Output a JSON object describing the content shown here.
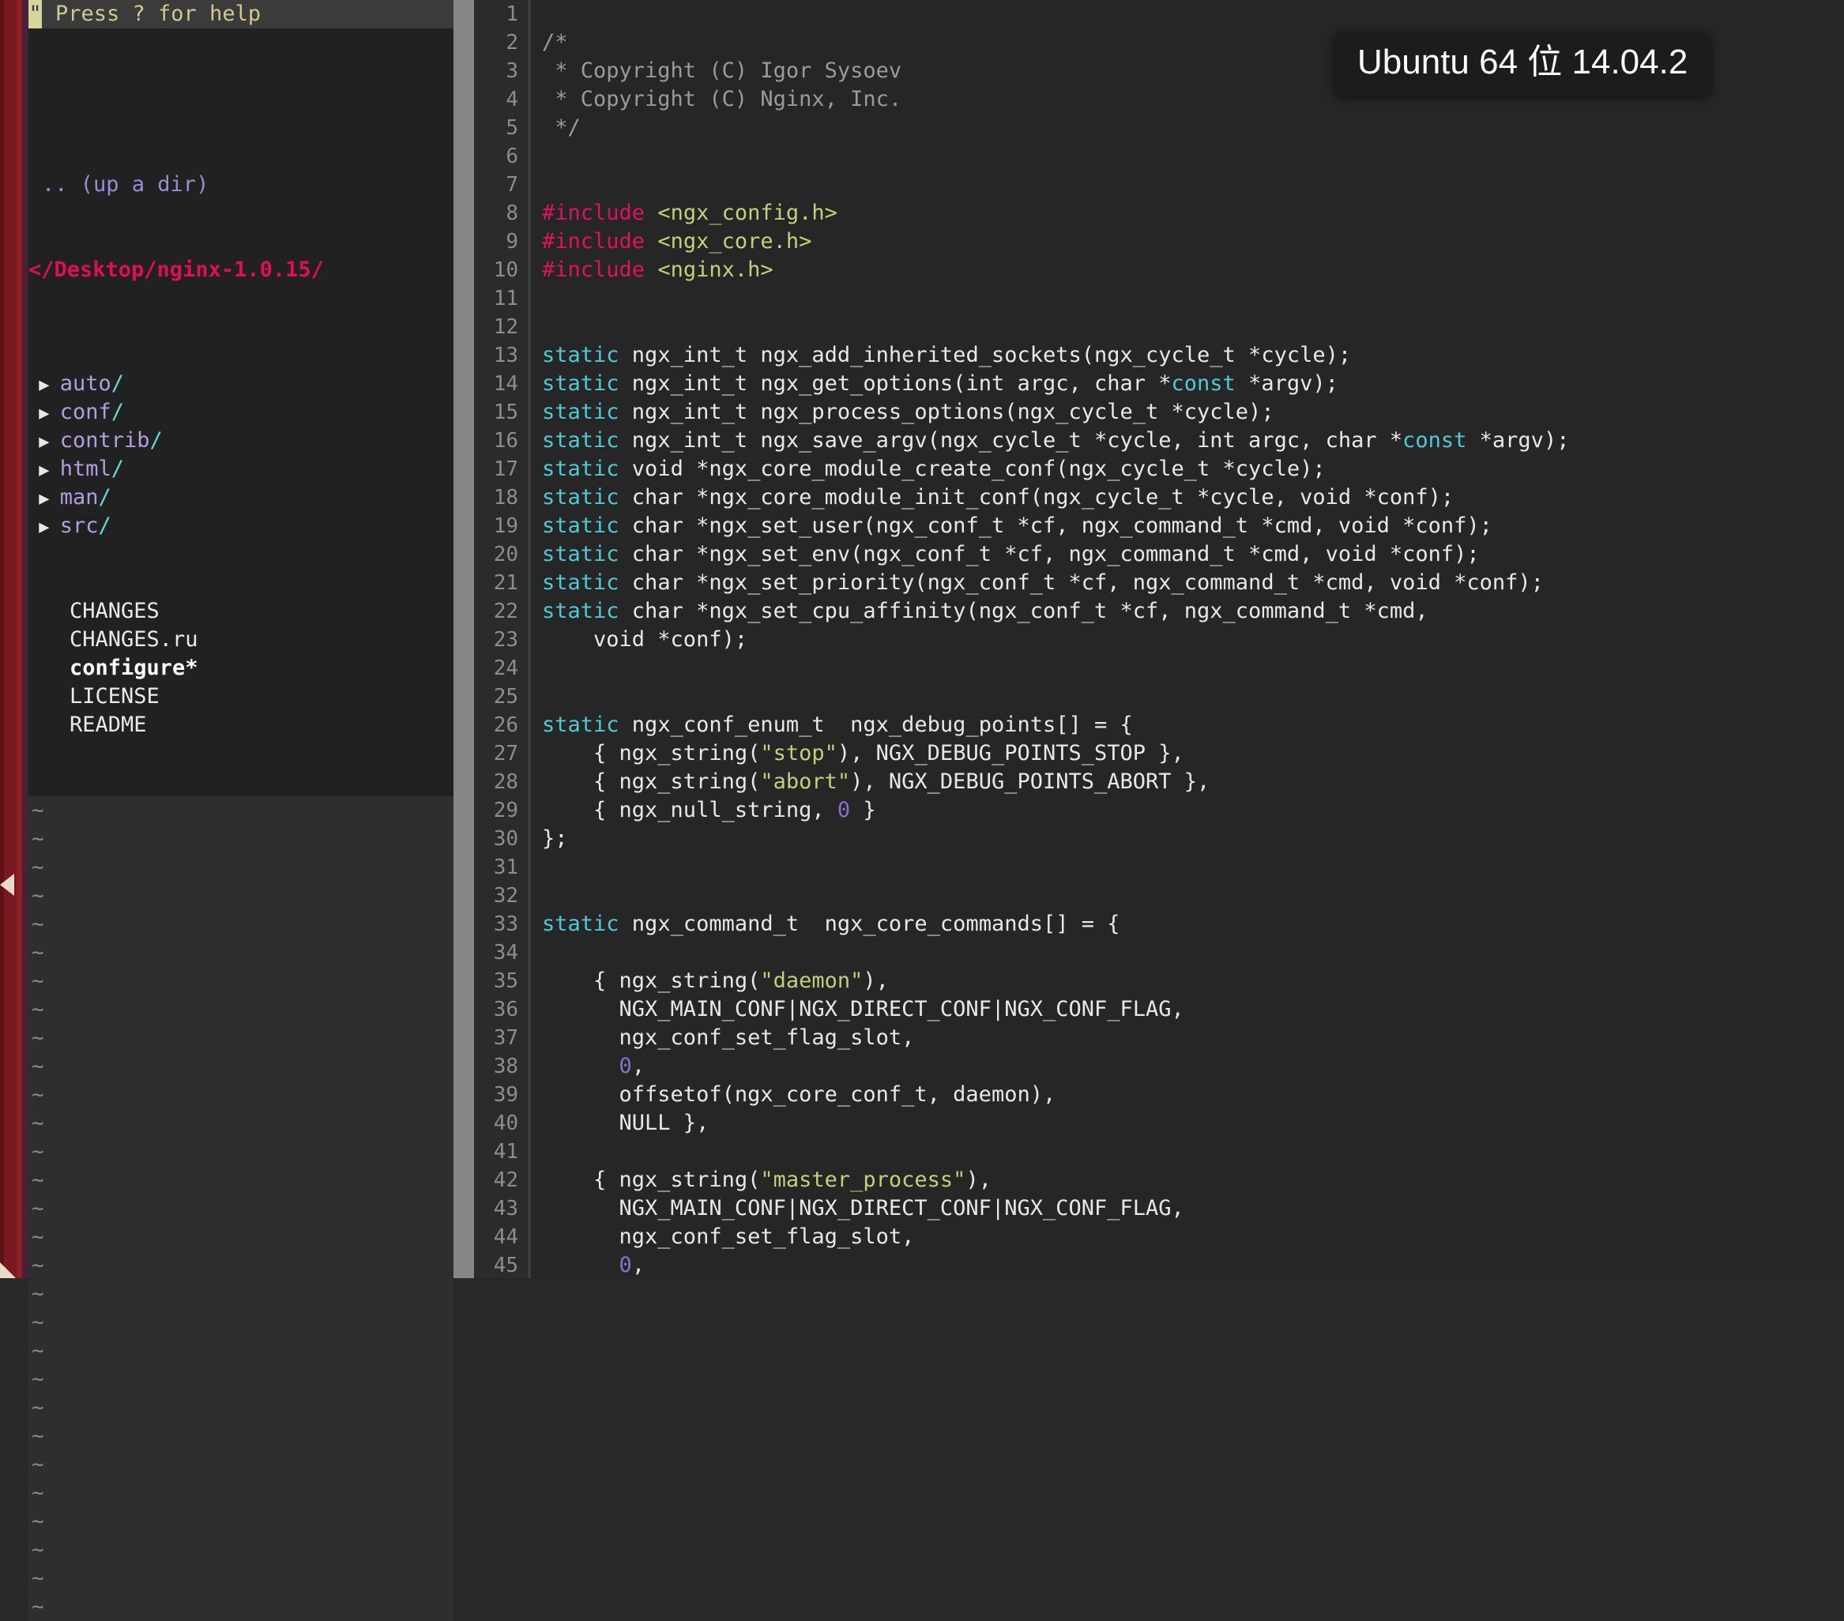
{
  "vm_overlay": {
    "title": "Ubuntu 64 位 14.04.2"
  },
  "nerdtree": {
    "help_hint": "Press ? for help",
    "cursor_char": "\"",
    "up_a_dir": ".. (up a dir)",
    "root_path": "</Desktop/nginx-1.0.15/",
    "arrow_glyph": "▶",
    "directories": [
      {
        "name": "auto",
        "slash": "/"
      },
      {
        "name": "conf",
        "slash": "/"
      },
      {
        "name": "contrib",
        "slash": "/"
      },
      {
        "name": "html",
        "slash": "/"
      },
      {
        "name": "man",
        "slash": "/"
      },
      {
        "name": "src",
        "slash": "/"
      }
    ],
    "files": [
      {
        "name": "CHANGES",
        "executable": false
      },
      {
        "name": "CHANGES.ru",
        "executable": false
      },
      {
        "name": "configure*",
        "executable": true
      },
      {
        "name": "LICENSE",
        "executable": false
      },
      {
        "name": "README",
        "executable": false
      }
    ],
    "empty_marker": "~",
    "empty_marker_count": 29
  },
  "editor": {
    "line_numbers": [
      1,
      2,
      3,
      4,
      5,
      6,
      7,
      8,
      9,
      10,
      11,
      12,
      13,
      14,
      15,
      16,
      17,
      18,
      19,
      20,
      21,
      22,
      23,
      24,
      25,
      26,
      27,
      28,
      29,
      30,
      31,
      32,
      33,
      34,
      35,
      36,
      37,
      38,
      39,
      40,
      41,
      42,
      43,
      44,
      45
    ],
    "lines": [
      {
        "n": 1,
        "tokens": []
      },
      {
        "n": 2,
        "tokens": [
          {
            "t": "/*",
            "c": "k-comment"
          }
        ]
      },
      {
        "n": 3,
        "tokens": [
          {
            "t": " * Copyright (C) Igor Sysoev",
            "c": "k-comment"
          }
        ]
      },
      {
        "n": 4,
        "tokens": [
          {
            "t": " * Copyright (C) Nginx, Inc.",
            "c": "k-comment"
          }
        ]
      },
      {
        "n": 5,
        "tokens": [
          {
            "t": " */",
            "c": "k-comment"
          }
        ]
      },
      {
        "n": 6,
        "tokens": []
      },
      {
        "n": 7,
        "tokens": []
      },
      {
        "n": 8,
        "tokens": [
          {
            "t": "#include",
            "c": "k-pre"
          },
          {
            "t": " ",
            "c": "k-plain"
          },
          {
            "t": "<ngx_config.h>",
            "c": "k-header"
          }
        ]
      },
      {
        "n": 9,
        "tokens": [
          {
            "t": "#include",
            "c": "k-pre"
          },
          {
            "t": " ",
            "c": "k-plain"
          },
          {
            "t": "<ngx_core.h>",
            "c": "k-header"
          }
        ]
      },
      {
        "n": 10,
        "tokens": [
          {
            "t": "#include",
            "c": "k-pre"
          },
          {
            "t": " ",
            "c": "k-plain"
          },
          {
            "t": "<nginx.h>",
            "c": "k-header"
          }
        ]
      },
      {
        "n": 11,
        "tokens": []
      },
      {
        "n": 12,
        "tokens": []
      },
      {
        "n": 13,
        "tokens": [
          {
            "t": "static",
            "c": "k-kw"
          },
          {
            "t": " ngx_int_t ngx_add_inherited_sockets(ngx_cycle_t *cycle);",
            "c": "k-plain"
          }
        ]
      },
      {
        "n": 14,
        "tokens": [
          {
            "t": "static",
            "c": "k-kw"
          },
          {
            "t": " ngx_int_t ngx_get_options(int argc, char *",
            "c": "k-plain"
          },
          {
            "t": "const",
            "c": "k-kw"
          },
          {
            "t": " *argv);",
            "c": "k-plain"
          }
        ]
      },
      {
        "n": 15,
        "tokens": [
          {
            "t": "static",
            "c": "k-kw"
          },
          {
            "t": " ngx_int_t ngx_process_options(ngx_cycle_t *cycle);",
            "c": "k-plain"
          }
        ]
      },
      {
        "n": 16,
        "tokens": [
          {
            "t": "static",
            "c": "k-kw"
          },
          {
            "t": " ngx_int_t ngx_save_argv(ngx_cycle_t *cycle, int argc, char *",
            "c": "k-plain"
          },
          {
            "t": "const",
            "c": "k-kw"
          },
          {
            "t": " *argv);",
            "c": "k-plain"
          }
        ]
      },
      {
        "n": 17,
        "tokens": [
          {
            "t": "static",
            "c": "k-kw"
          },
          {
            "t": " void *ngx_core_module_create_conf(ngx_cycle_t *cycle);",
            "c": "k-plain"
          }
        ]
      },
      {
        "n": 18,
        "tokens": [
          {
            "t": "static",
            "c": "k-kw"
          },
          {
            "t": " char *ngx_core_module_init_conf(ngx_cycle_t *cycle, void *conf);",
            "c": "k-plain"
          }
        ]
      },
      {
        "n": 19,
        "tokens": [
          {
            "t": "static",
            "c": "k-kw"
          },
          {
            "t": " char *ngx_set_user(ngx_conf_t *cf, ngx_command_t *cmd, void *conf);",
            "c": "k-plain"
          }
        ]
      },
      {
        "n": 20,
        "tokens": [
          {
            "t": "static",
            "c": "k-kw"
          },
          {
            "t": " char *ngx_set_env(ngx_conf_t *cf, ngx_command_t *cmd, void *conf);",
            "c": "k-plain"
          }
        ]
      },
      {
        "n": 21,
        "tokens": [
          {
            "t": "static",
            "c": "k-kw"
          },
          {
            "t": " char *ngx_set_priority(ngx_conf_t *cf, ngx_command_t *cmd, void *conf);",
            "c": "k-plain"
          }
        ]
      },
      {
        "n": 22,
        "tokens": [
          {
            "t": "static",
            "c": "k-kw"
          },
          {
            "t": " char *ngx_set_cpu_affinity(ngx_conf_t *cf, ngx_command_t *cmd,",
            "c": "k-plain"
          }
        ]
      },
      {
        "n": 23,
        "tokens": [
          {
            "t": "    void *conf);",
            "c": "k-plain"
          }
        ]
      },
      {
        "n": 24,
        "tokens": []
      },
      {
        "n": 25,
        "tokens": []
      },
      {
        "n": 26,
        "tokens": [
          {
            "t": "static",
            "c": "k-kw"
          },
          {
            "t": " ngx_conf_enum_t  ngx_debug_points[] = {",
            "c": "k-plain"
          }
        ]
      },
      {
        "n": 27,
        "tokens": [
          {
            "t": "    { ngx_string(",
            "c": "k-plain"
          },
          {
            "t": "\"stop\"",
            "c": "k-str"
          },
          {
            "t": "), NGX_DEBUG_POINTS_STOP },",
            "c": "k-plain"
          }
        ]
      },
      {
        "n": 28,
        "tokens": [
          {
            "t": "    { ngx_string(",
            "c": "k-plain"
          },
          {
            "t": "\"abort\"",
            "c": "k-str"
          },
          {
            "t": "), NGX_DEBUG_POINTS_ABORT },",
            "c": "k-plain"
          }
        ]
      },
      {
        "n": 29,
        "tokens": [
          {
            "t": "    { ngx_null_string, ",
            "c": "k-plain"
          },
          {
            "t": "0",
            "c": "k-num"
          },
          {
            "t": " }",
            "c": "k-plain"
          }
        ]
      },
      {
        "n": 30,
        "tokens": [
          {
            "t": "};",
            "c": "k-plain"
          }
        ]
      },
      {
        "n": 31,
        "tokens": []
      },
      {
        "n": 32,
        "tokens": []
      },
      {
        "n": 33,
        "tokens": [
          {
            "t": "static",
            "c": "k-kw"
          },
          {
            "t": " ngx_command_t  ngx_core_commands[] = {",
            "c": "k-plain"
          }
        ]
      },
      {
        "n": 34,
        "tokens": []
      },
      {
        "n": 35,
        "tokens": [
          {
            "t": "    { ngx_string(",
            "c": "k-plain"
          },
          {
            "t": "\"daemon\"",
            "c": "k-str"
          },
          {
            "t": "),",
            "c": "k-plain"
          }
        ]
      },
      {
        "n": 36,
        "tokens": [
          {
            "t": "      NGX_MAIN_CONF|NGX_DIRECT_CONF|NGX_CONF_FLAG,",
            "c": "k-plain"
          }
        ]
      },
      {
        "n": 37,
        "tokens": [
          {
            "t": "      ngx_conf_set_flag_slot,",
            "c": "k-plain"
          }
        ]
      },
      {
        "n": 38,
        "tokens": [
          {
            "t": "      ",
            "c": "k-plain"
          },
          {
            "t": "0",
            "c": "k-num"
          },
          {
            "t": ",",
            "c": "k-plain"
          }
        ]
      },
      {
        "n": 39,
        "tokens": [
          {
            "t": "      offsetof(ngx_core_conf_t, daemon),",
            "c": "k-plain"
          }
        ]
      },
      {
        "n": 40,
        "tokens": [
          {
            "t": "      NULL },",
            "c": "k-plain"
          }
        ]
      },
      {
        "n": 41,
        "tokens": []
      },
      {
        "n": 42,
        "tokens": [
          {
            "t": "    { ngx_string(",
            "c": "k-plain"
          },
          {
            "t": "\"master_process\"",
            "c": "k-str"
          },
          {
            "t": "),",
            "c": "k-plain"
          }
        ]
      },
      {
        "n": 43,
        "tokens": [
          {
            "t": "      NGX_MAIN_CONF|NGX_DIRECT_CONF|NGX_CONF_FLAG,",
            "c": "k-plain"
          }
        ]
      },
      {
        "n": 44,
        "tokens": [
          {
            "t": "      ngx_conf_set_flag_slot,",
            "c": "k-plain"
          }
        ]
      },
      {
        "n": 45,
        "tokens": [
          {
            "t": "      ",
            "c": "k-plain"
          },
          {
            "t": "0",
            "c": "k-num"
          },
          {
            "t": ",",
            "c": "k-plain"
          }
        ]
      }
    ]
  },
  "colors": {
    "editor_bg": "#262626",
    "nerdtree_bg": "#212121",
    "pane_bg": "#2e2e2e",
    "keyword": "#4ec9d8",
    "preproc": "#e0115f",
    "string": "#c5cf7a",
    "number": "#8a6fd0",
    "comment": "#9a9a9a",
    "dir": "#b09ee0",
    "path": "#e01050",
    "splitbar": "#868686",
    "edge_strip": "#7a1820"
  }
}
